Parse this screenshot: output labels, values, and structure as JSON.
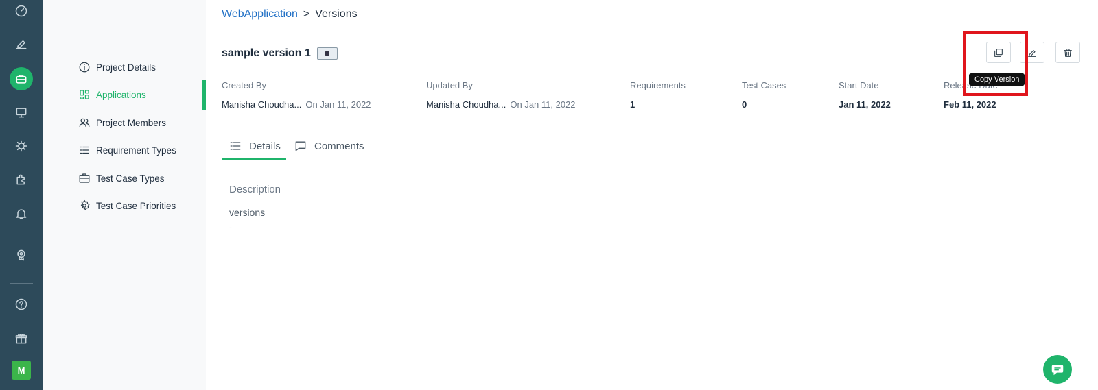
{
  "rail": {
    "avatar_initial": "M"
  },
  "subnav": {
    "items": [
      {
        "label": "Project Details",
        "icon": "info-icon"
      },
      {
        "label": "Applications",
        "icon": "grid-icon",
        "active": true
      },
      {
        "label": "Project Members",
        "icon": "users-icon"
      },
      {
        "label": "Requirement Types",
        "icon": "list-icon"
      },
      {
        "label": "Test Case Types",
        "icon": "briefcase-icon"
      },
      {
        "label": "Test Case Priorities",
        "icon": "gear-icon"
      }
    ]
  },
  "breadcrumb": {
    "parent": "WebApplication",
    "separator": ">",
    "current": "Versions"
  },
  "version": {
    "title": "sample version 1"
  },
  "actions": {
    "copy_tooltip": "Copy Version"
  },
  "meta": {
    "created_by_label": "Created By",
    "created_by_name": "Manisha Choudha...",
    "created_on": "On Jan 11, 2022",
    "updated_by_label": "Updated By",
    "updated_by_name": "Manisha Choudha...",
    "updated_on": "On Jan 11, 2022",
    "requirements_label": "Requirements",
    "requirements_value": "1",
    "test_cases_label": "Test Cases",
    "test_cases_value": "0",
    "start_date_label": "Start Date",
    "start_date_value": "Jan 11, 2022",
    "release_date_label": "Release Date",
    "release_date_value": "Feb 11, 2022"
  },
  "tabs": {
    "details": "Details",
    "comments": "Comments"
  },
  "details": {
    "description_label": "Description",
    "description_value": "versions",
    "empty_value": "-"
  },
  "colors": {
    "accent": "#1fb46b",
    "rail": "#2d4a5a",
    "link": "#1f6fc5",
    "highlight": "#e0161d"
  }
}
